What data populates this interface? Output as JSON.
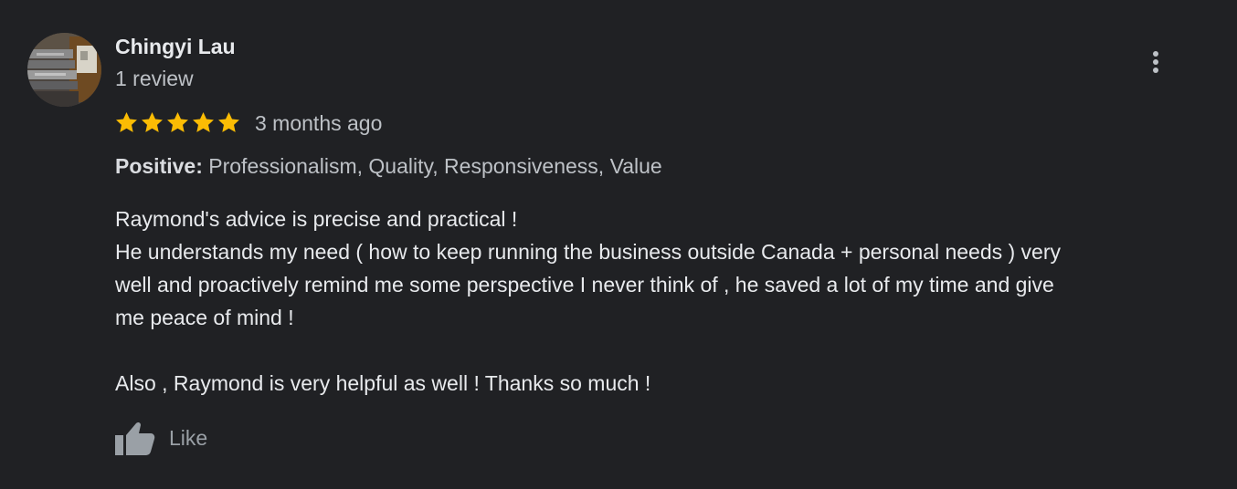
{
  "review": {
    "author_name": "Chingyi Lau",
    "author_meta": "1 review",
    "rating": 5,
    "rating_max": 5,
    "date": "3 months ago",
    "attributes_label": "Positive:",
    "attributes_value": " Professionalism, Quality, Responsiveness, Value",
    "text_lines": [
      "Raymond's advice is precise and practical !",
      "He understands my need  ( how to keep running the business outside Canada + personal needs ) very",
      "well and proactively remind me some perspective I never think of , he saved a lot of my time and give",
      "me peace of mind !",
      "",
      "Also , Raymond is very helpful as well !  Thanks so much !"
    ],
    "like_label": "Like"
  },
  "icons": {
    "more": "more-vert-icon",
    "like": "thumb-up-icon",
    "star": "star-icon"
  },
  "colors": {
    "background": "#202124",
    "star": "#fbbc04",
    "text_primary": "#e8eaed",
    "text_secondary": "#bdc1c6"
  }
}
